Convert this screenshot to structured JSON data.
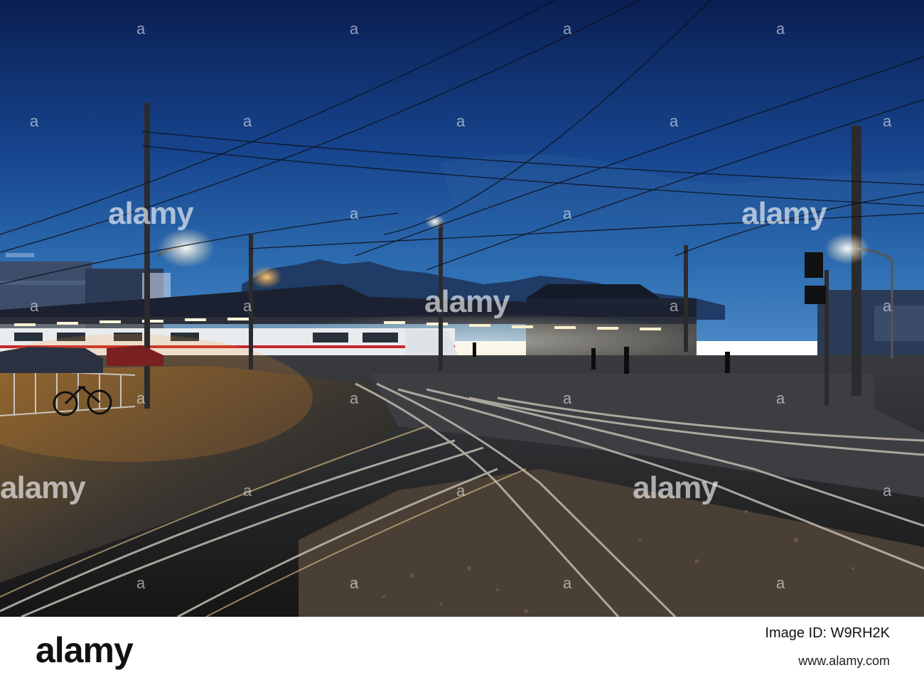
{
  "watermark": {
    "text": "alamy",
    "dot": "a"
  },
  "footer": {
    "logo": "alamy",
    "image_id_label": "Image ID: W9RH2K",
    "url": "www.alamy.com"
  },
  "colors": {
    "sky_top": "#0b2357",
    "sky_horizon": "#3a7fc0",
    "lamp": "#f5a640",
    "platform_light": "#fff3cf"
  }
}
